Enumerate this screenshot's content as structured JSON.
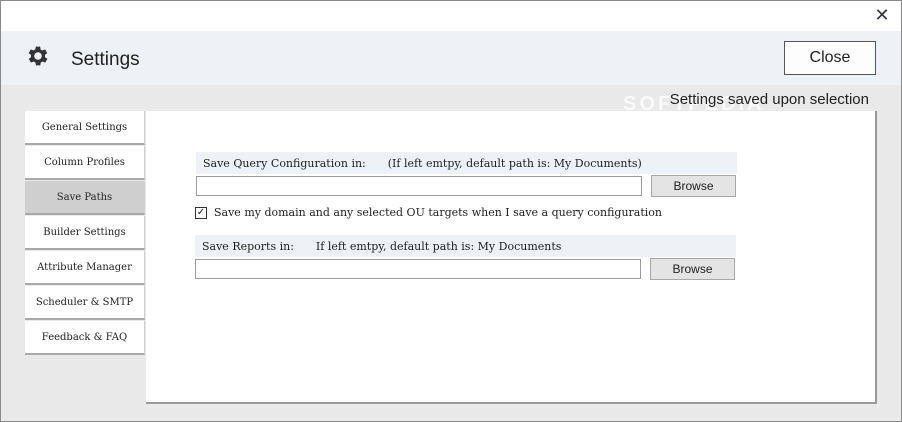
{
  "window": {
    "close_glyph": "✕"
  },
  "header": {
    "title": "Settings",
    "icon": "gear-icon",
    "close_button": "Close"
  },
  "status": "Settings saved upon selection",
  "watermark": "SOFTPEDIA",
  "sidebar": {
    "items": [
      {
        "label": "General Settings",
        "active": false
      },
      {
        "label": "Column Profiles",
        "active": false
      },
      {
        "label": "Save Paths",
        "active": true
      },
      {
        "label": "Builder Settings",
        "active": false
      },
      {
        "label": "Attribute Manager",
        "active": false
      },
      {
        "label": "Scheduler & SMTP",
        "active": false
      },
      {
        "label": "Feedback & FAQ",
        "active": false
      }
    ]
  },
  "query_section": {
    "label": "Save Query Configuration in:",
    "hint": "(If left emtpy, default path is: My Documents)",
    "value": "",
    "browse": "Browse"
  },
  "checkbox": {
    "checked": true,
    "label": "Save my domain and any selected OU targets when I save a query configuration"
  },
  "reports_section": {
    "label": "Save Reports in:",
    "hint": "If left emtpy, default path is: My Documents",
    "value": "",
    "browse": "Browse"
  },
  "colors": {
    "header_bg": "#eef1f6",
    "body_bg": "#e9e9e9",
    "active_nav": "#cfcfcf"
  }
}
